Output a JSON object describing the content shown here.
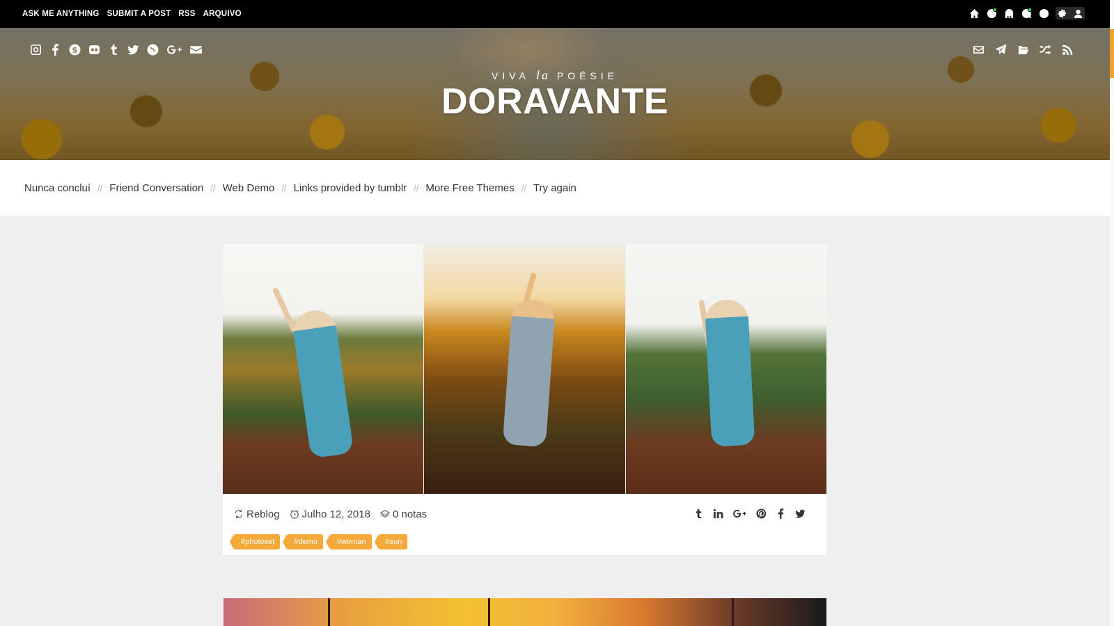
{
  "topbar": {
    "links": [
      "ASK ME ANYTHING",
      "SUBMIT A POST",
      "RSS",
      "ARQUIVO"
    ],
    "controls": [
      "home-icon",
      "message-icon",
      "ghost-icon",
      "chat-icon",
      "face-icon",
      "gear-icon",
      "user-icon"
    ]
  },
  "header": {
    "tagline_pre": "VIVA",
    "tagline_mid": "la",
    "tagline_post": "POÉSIE",
    "title": "DORAVANTE",
    "social_icons": [
      "instagram-icon",
      "facebook-icon",
      "skype-icon",
      "flickr-icon",
      "tumblr-icon",
      "twitter-icon",
      "globe-icon",
      "google-plus-icon",
      "envelope-icon"
    ],
    "right_icons": [
      "mail-icon",
      "send-icon",
      "folder-icon",
      "shuffle-icon",
      "rss-icon"
    ]
  },
  "nav": {
    "items": [
      "Nunca concluí",
      "Friend Conversation",
      "Web Demo",
      "Links provided by tumblr",
      "More Free Themes",
      "Try again"
    ],
    "separator": "//"
  },
  "post": {
    "reblog": "Reblog",
    "date": "Julho 12, 2018",
    "notes": "0 notas",
    "share_icons": [
      "tumblr-icon",
      "linkedin-icon",
      "google-plus-icon",
      "pinterest-icon",
      "facebook-icon",
      "twitter-icon"
    ],
    "tags": [
      "#photoset",
      "#demo",
      "#woman",
      "#sun"
    ]
  },
  "colors": {
    "accent": "#f4a93a",
    "topbar": "#000000",
    "nav_bg": "#ffffff",
    "page_bg": "#efefef"
  }
}
